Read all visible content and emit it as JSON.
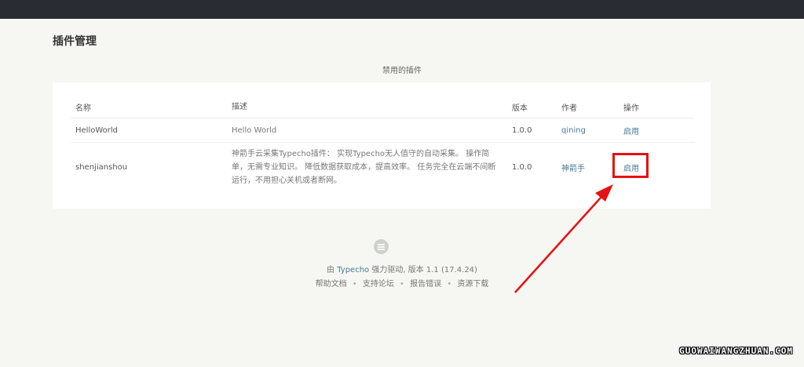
{
  "page": {
    "title": "插件管理",
    "section_title": "禁用的插件"
  },
  "table": {
    "columns": [
      "名称",
      "描述",
      "版本",
      "作者",
      "操作"
    ],
    "rows": [
      {
        "name": "HelloWorld",
        "description": "Hello World",
        "version": "1.0.0",
        "author": "qining",
        "action": "启用"
      },
      {
        "name": "shenjianshou",
        "description": "神箭手云采集Typecho插件： 实现Typecho无人值守的自动采集。 操作简单，无需专业知识。 降低数据获取成本，提高效率。 任务完全在云端不间断运行，不用担心关机或者断网。",
        "version": "1.0.0",
        "author": "神箭手",
        "action": "启用"
      }
    ]
  },
  "footer": {
    "prefix": "由",
    "brand": "Typecho",
    "suffix": "强力驱动, 版本 1.1 (17.4.24)",
    "links": [
      "帮助文档",
      "支持论坛",
      "报告错误",
      "资源下载"
    ],
    "separator": "•"
  },
  "watermark": "GUOWAIWANGZHUAN.COM",
  "colors": {
    "topbar": "#292d33",
    "link": "#467b96",
    "highlight": "#e41212"
  },
  "icons": {
    "footer_logo": "typecho-logo-icon",
    "pointer": "red-arrow-icon"
  }
}
